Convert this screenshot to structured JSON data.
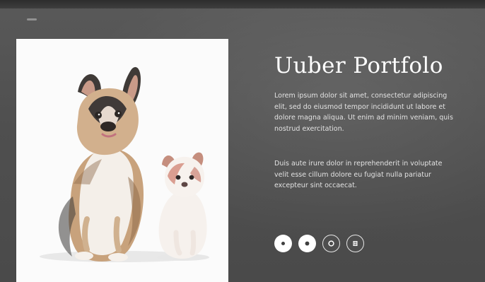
{
  "title": "Uuber Portfolo",
  "intro_text": "Lorem ipsum dolor sit amet, consectetur adipiscing elit, sed do eiusmod tempor incididunt ut labore et dolore magna aliqua. Ut enim ad minim veniam, quis nostrud exercitation.",
  "secondary_text": "Duis aute irure dolor in reprehenderit in voluptate velit esse cillum dolore eu fugiat nulla pariatur excepteur sint occaecat.",
  "social_links": [
    {
      "icon": "circle-dot-icon"
    },
    {
      "icon": "circle-dot-icon"
    },
    {
      "icon": "circle-outline-icon"
    },
    {
      "icon": "social-link-icon"
    }
  ],
  "colors": {
    "background": "#4f4f4f",
    "panel": "#fbfbfb",
    "text": "#f1f1f1"
  }
}
